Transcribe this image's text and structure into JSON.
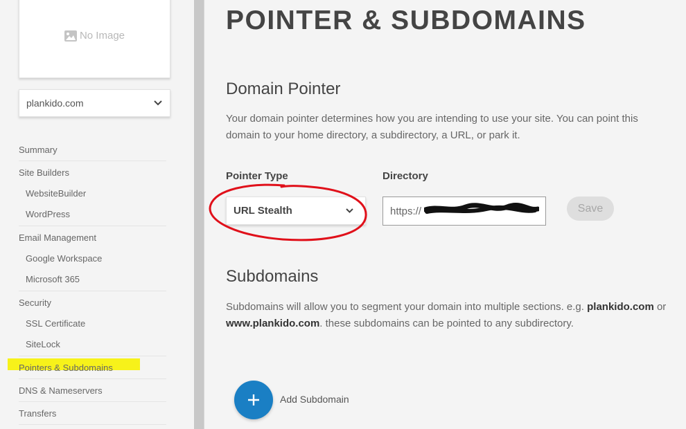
{
  "sidebar": {
    "no_image_text": "No Image",
    "domain_value": "plankido.com",
    "nav": {
      "summary": "Summary",
      "site_builders": "Site Builders",
      "website_builder": "WebsiteBuilder",
      "wordpress": "WordPress",
      "email_management": "Email Management",
      "google_workspace": "Google Workspace",
      "microsoft_365": "Microsoft 365",
      "security": "Security",
      "ssl_certificate": "SSL Certificate",
      "sitelock": "SiteLock",
      "pointers_subdomains": "Pointers & Subdomains",
      "dns_nameservers": "DNS & Nameservers",
      "transfers": "Transfers"
    }
  },
  "main": {
    "title": "POINTER & SUBDOMAINS",
    "domain_pointer": {
      "heading": "Domain Pointer",
      "description": "Your domain pointer determines how you are intending to use your site. You can point this domain to your home directory, a subdirectory, a URL, or park it.",
      "pointer_type_label": "Pointer Type",
      "pointer_type_value": "URL Stealth",
      "directory_label": "Directory",
      "directory_value": "https://",
      "save_label": "Save"
    },
    "subdomains": {
      "heading": "Subdomains",
      "desc_part1": "Subdomains will allow you to segment your domain into multiple sections. e.g. ",
      "example1": "plankido.com",
      "desc_or": " or ",
      "example2": "www.plankido.com",
      "desc_part2": ". these subdomains can be pointed to any subdirectory.",
      "add_label": "Add Subdomain"
    }
  },
  "colors": {
    "accent_blue": "#1a7fc4",
    "highlight_yellow": "#f7f21a",
    "annotation_red": "#e0101a"
  }
}
